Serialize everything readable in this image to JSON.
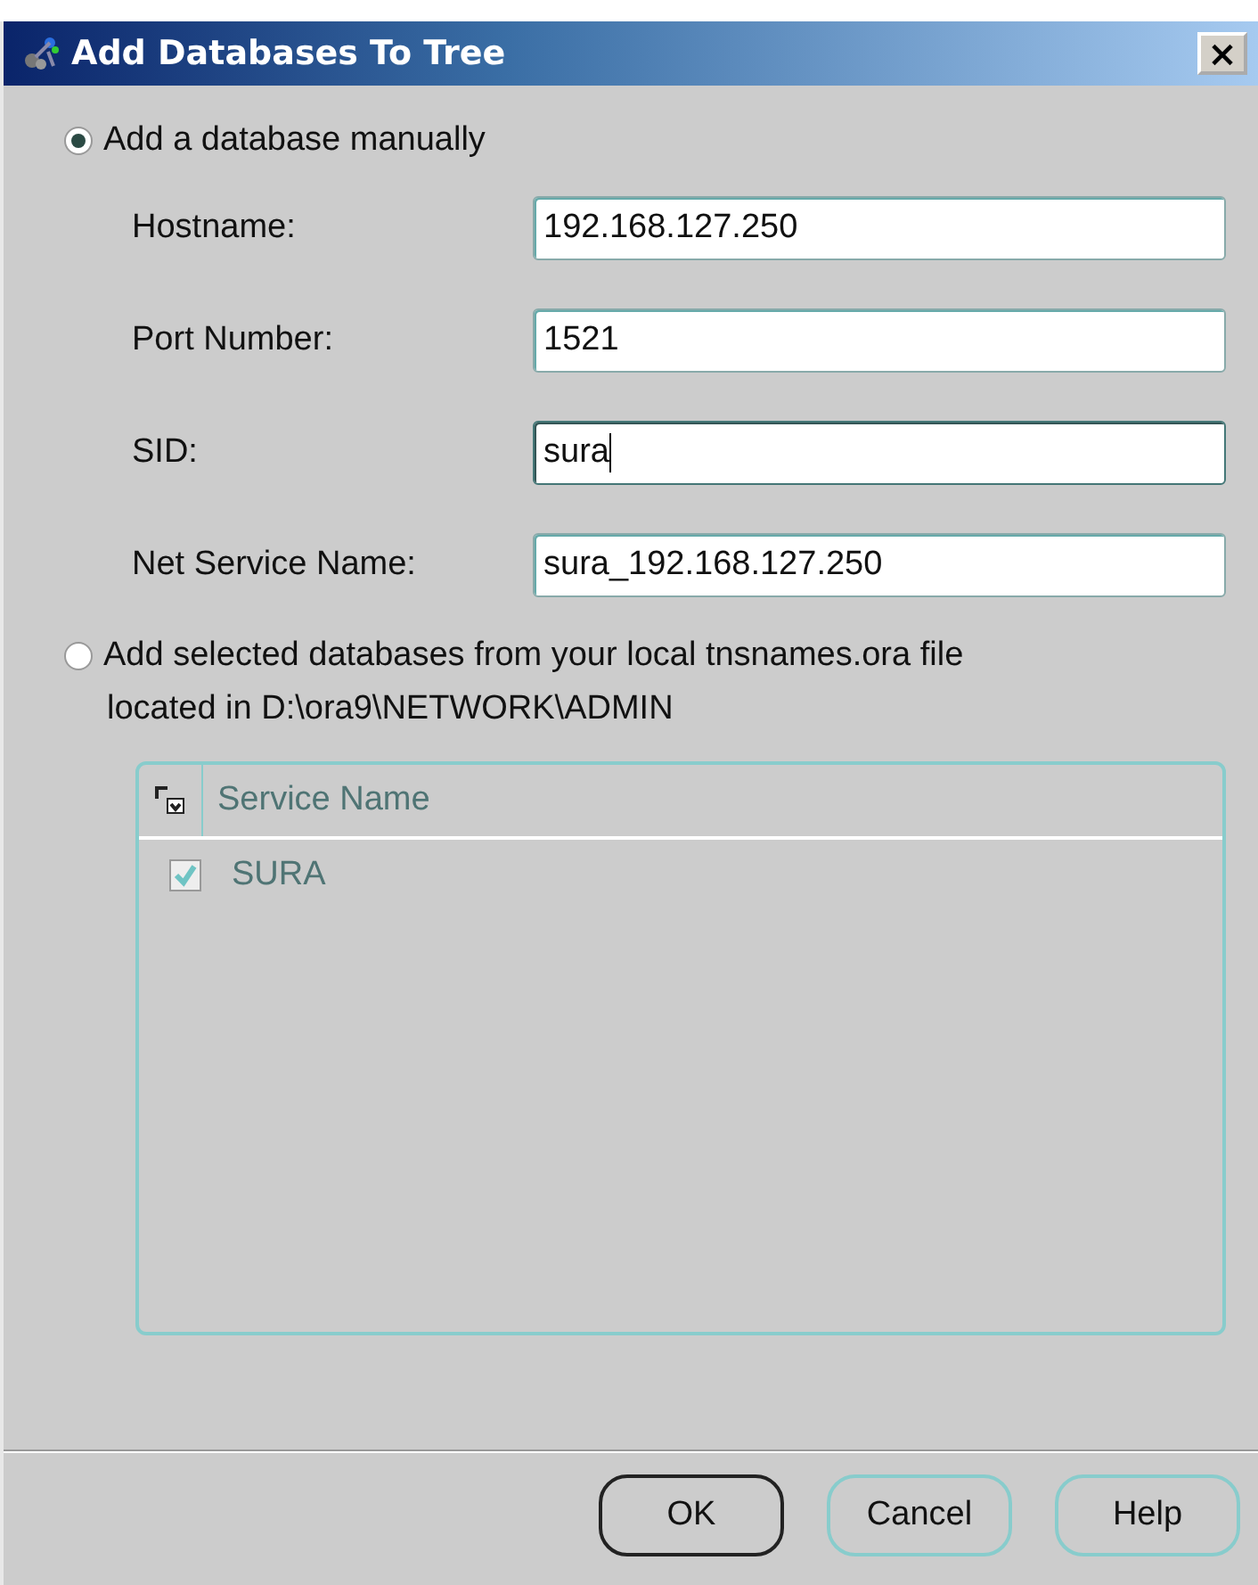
{
  "window": {
    "title": "Add Databases To Tree",
    "close": "×"
  },
  "options": [
    {
      "label": "Add a database manually",
      "selected": true,
      "kind": "manual"
    },
    {
      "label": "Add selected databases from your local tnsnames.ora file",
      "note": "located in D:\\ora9\\NETWORK\\ADMIN",
      "selected": false,
      "kind": "tnsnames"
    }
  ],
  "fields": [
    {
      "label": "Hostname:",
      "value": "192.168.127.250",
      "focused": false
    },
    {
      "label": "Port Number:",
      "value": "1521",
      "focused": false
    },
    {
      "label": "SID:",
      "value": "sura",
      "focused": true
    },
    {
      "label": "Net Service Name:",
      "value": "sura_192.168.127.250",
      "focused": false
    }
  ],
  "table": {
    "disabled": true,
    "columns": [
      "Service Name"
    ],
    "rows": [
      {
        "checked": true,
        "name": "SURA"
      }
    ]
  },
  "buttons": [
    {
      "label": "OK",
      "default": true
    },
    {
      "label": "Cancel",
      "default": false
    },
    {
      "label": "Help",
      "default": false
    }
  ]
}
